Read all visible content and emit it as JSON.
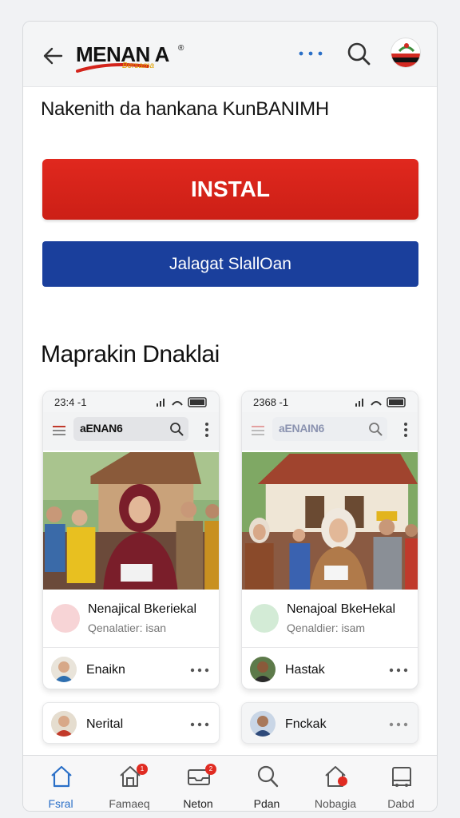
{
  "header": {
    "logo_text": "MENAN A",
    "logo_tagline": "Bersama",
    "logo_mark": "®",
    "icons": [
      "back-arrow-icon",
      "more-horizontal-icon",
      "search-icon",
      "flag-avatar"
    ]
  },
  "headline": "Nakenith da hankana KunBANIMH",
  "install_button": "INSTAL",
  "secondary_button": "Jalagat SlallOan",
  "section_title": "Maprakin Dnaklai",
  "previews": [
    {
      "time": "23:4 -1",
      "brand": "aENAN6",
      "title": "Nenajical Bkeriekal",
      "subtitle": "Qenalatier: isan",
      "dot_color": "#f7d4d6",
      "user": "Enaikn"
    },
    {
      "time": "2368 -1",
      "brand": "aENAIN6",
      "title": "Nenajoal BkeHekal",
      "subtitle": "Qenaldier: isam",
      "dot_color": "#d3ebd6",
      "user": "Hastak"
    }
  ],
  "mini_cards": [
    {
      "user": "Nerital"
    },
    {
      "user": "Fnckak"
    }
  ],
  "bottom_nav": [
    {
      "label": "Fsral",
      "icon": "home-icon",
      "active": true
    },
    {
      "label": "Famaeq",
      "icon": "house-badge-icon",
      "badge": "1"
    },
    {
      "label": "Neton",
      "icon": "inbox-icon",
      "badge": "2"
    },
    {
      "label": "Pdan",
      "icon": "search-icon"
    },
    {
      "label": "Nobagia",
      "icon": "house-alert-icon"
    },
    {
      "label": "Dabd",
      "icon": "device-icon"
    }
  ],
  "colors": {
    "install_red": "#d9241b",
    "secondary_blue": "#1a3f9c",
    "active_nav": "#2a6fc7"
  }
}
